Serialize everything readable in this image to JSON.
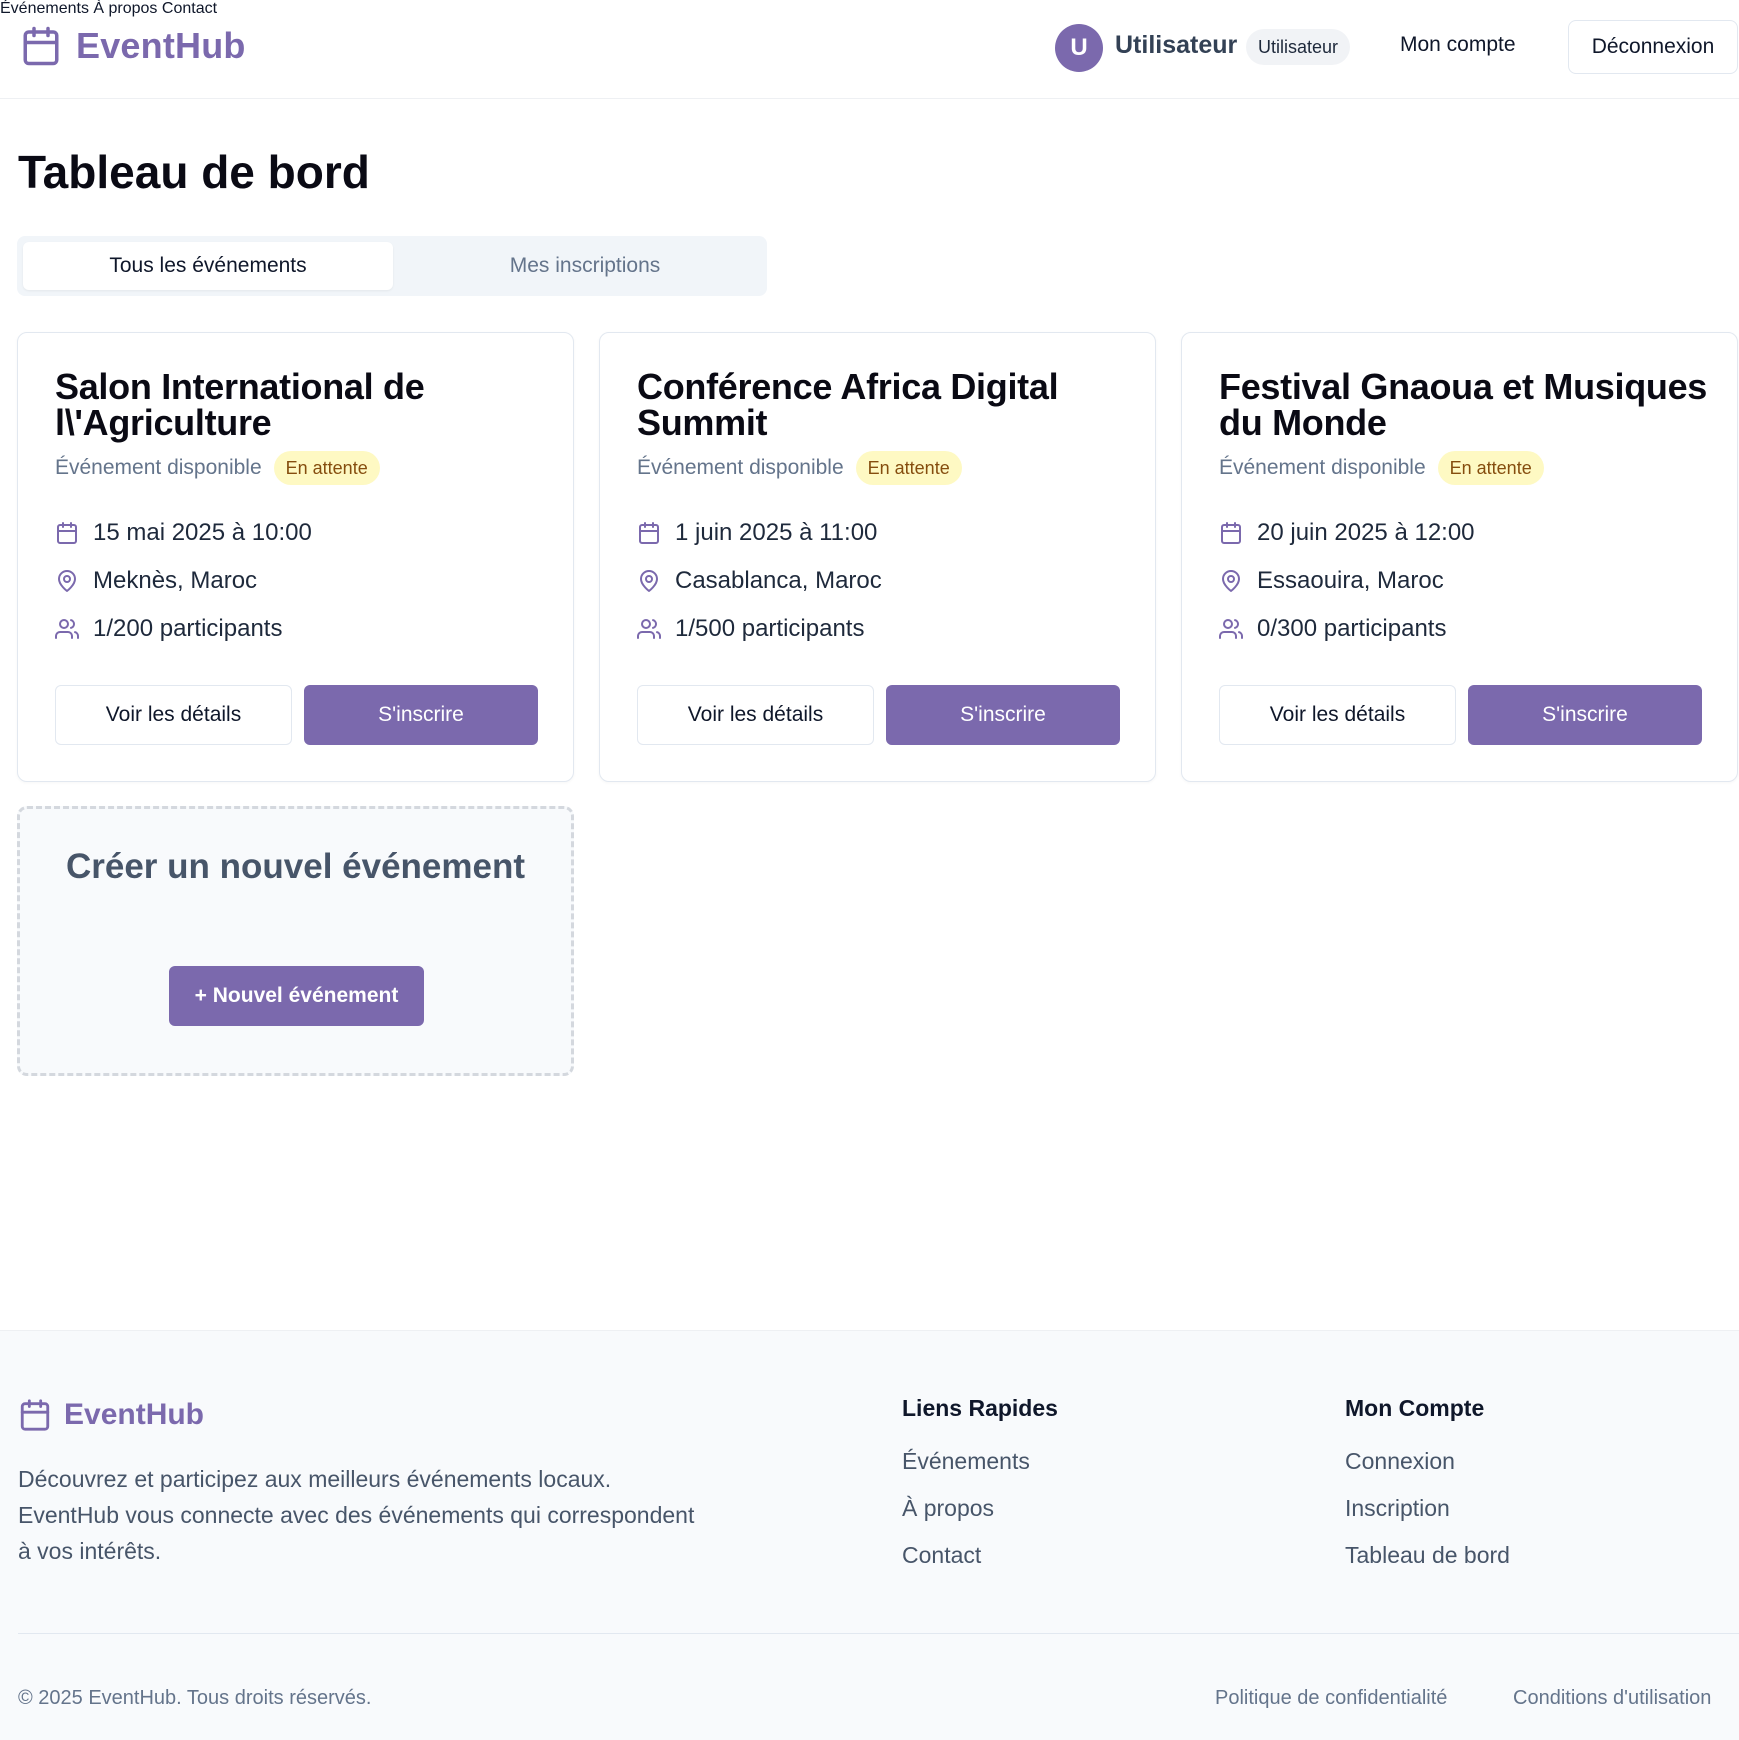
{
  "brand": {
    "name": "EventHub",
    "accent": "#7b69ad"
  },
  "nav": {
    "events": "Événements",
    "about": "À propos",
    "contact": "Contact"
  },
  "user": {
    "initial": "U",
    "name": "Utilisateur",
    "role": "Utilisateur",
    "account_label": "Mon compte",
    "logout_label": "Déconnexion"
  },
  "page": {
    "title": "Tableau de bord",
    "tabs": [
      {
        "label": "Tous les événements",
        "active": true
      },
      {
        "label": "Mes inscriptions",
        "active": false
      }
    ]
  },
  "events": [
    {
      "title": "Salon International de l\\'Agriculture",
      "availability": "Événement disponible",
      "status": "En attente",
      "date": "15 mai 2025 à 10:00",
      "location": "Meknès, Maroc",
      "participants": "1/200 participants",
      "details_label": "Voir les détails",
      "register_label": "S'inscrire"
    },
    {
      "title": "Conférence Africa Digital Summit",
      "availability": "Événement disponible",
      "status": "En attente",
      "date": "1 juin 2025 à 11:00",
      "location": "Casablanca, Maroc",
      "participants": "1/500 participants",
      "details_label": "Voir les détails",
      "register_label": "S'inscrire"
    },
    {
      "title": "Festival Gnaoua et Musiques du Monde",
      "availability": "Événement disponible",
      "status": "En attente",
      "date": "20 juin 2025 à 12:00",
      "location": "Essaouira, Maroc",
      "participants": "0/300 participants",
      "details_label": "Voir les détails",
      "register_label": "S'inscrire"
    }
  ],
  "create": {
    "title": "Créer un nouvel événement",
    "button_label": "+ Nouvel événement"
  },
  "footer": {
    "brand": "EventHub",
    "description": "Découvrez et participez aux meilleurs événements locaux. EventHub vous connecte avec des événements qui correspondent à vos intérêts.",
    "quick_links": {
      "heading": "Liens Rapides",
      "items": [
        "Événements",
        "À propos",
        "Contact"
      ]
    },
    "account": {
      "heading": "Mon Compte",
      "items": [
        "Connexion",
        "Inscription",
        "Tableau de bord"
      ]
    },
    "copyright": "© 2025 EventHub. Tous droits réservés.",
    "privacy": "Politique de confidentialité",
    "terms": "Conditions d'utilisation"
  },
  "icons": [
    "calendar-icon",
    "map-pin-icon",
    "users-icon"
  ]
}
